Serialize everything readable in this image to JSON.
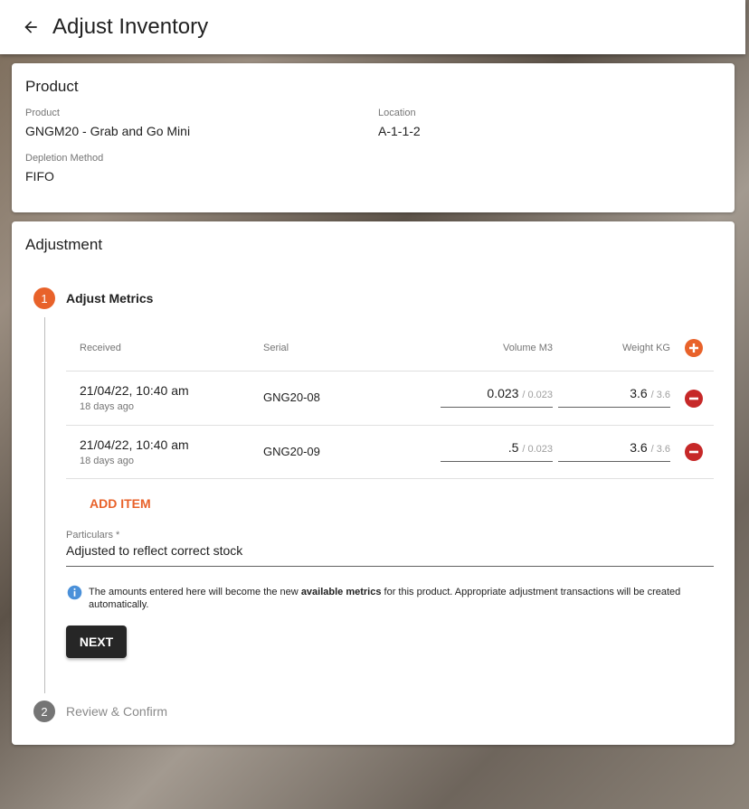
{
  "appbar": {
    "title": "Adjust Inventory"
  },
  "product_card": {
    "title": "Product",
    "product_label": "Product",
    "product_value": "GNGM20 - Grab and Go Mini",
    "location_label": "Location",
    "location_value": "A-1-1-2",
    "depletion_label": "Depletion Method",
    "depletion_value": "FIFO"
  },
  "adjust_card": {
    "title": "Adjustment",
    "steps": [
      {
        "number": "1",
        "label": "Adjust Metrics",
        "active": true
      },
      {
        "number": "2",
        "label": "Review & Confirm",
        "active": false
      }
    ],
    "table": {
      "headers": {
        "received": "Received",
        "serial": "Serial",
        "volume": "Volume M3",
        "weight": "Weight KG"
      },
      "rows": [
        {
          "date": "21/04/22, 10:40 am",
          "ago": "18 days ago",
          "serial": "GNG20-08",
          "volume": "0.023",
          "volume_max": "/ 0.023",
          "weight": "3.6",
          "weight_max": "/ 3.6"
        },
        {
          "date": "21/04/22, 10:40 am",
          "ago": "18 days ago",
          "serial": "GNG20-09",
          "volume": ".5",
          "volume_max": "/ 0.023",
          "weight": "3.6",
          "weight_max": "/ 3.6"
        }
      ]
    },
    "add_item_label": "ADD ITEM",
    "particulars_label": "Particulars *",
    "particulars_value": "Adjusted to reflect correct stock",
    "info_prefix": "The amounts entered here will become the new ",
    "info_bold": "available metrics",
    "info_suffix": " for this product. Appropriate adjustment transactions will be created automatically.",
    "next_label": "NEXT"
  },
  "colors": {
    "accent": "#e8622a",
    "remove": "#c62828",
    "dark_button": "#262626",
    "info": "#4a90d9"
  },
  "icons": {
    "back": "arrow-left-icon",
    "add": "plus-circle-icon",
    "remove": "minus-circle-icon",
    "info": "info-icon"
  }
}
